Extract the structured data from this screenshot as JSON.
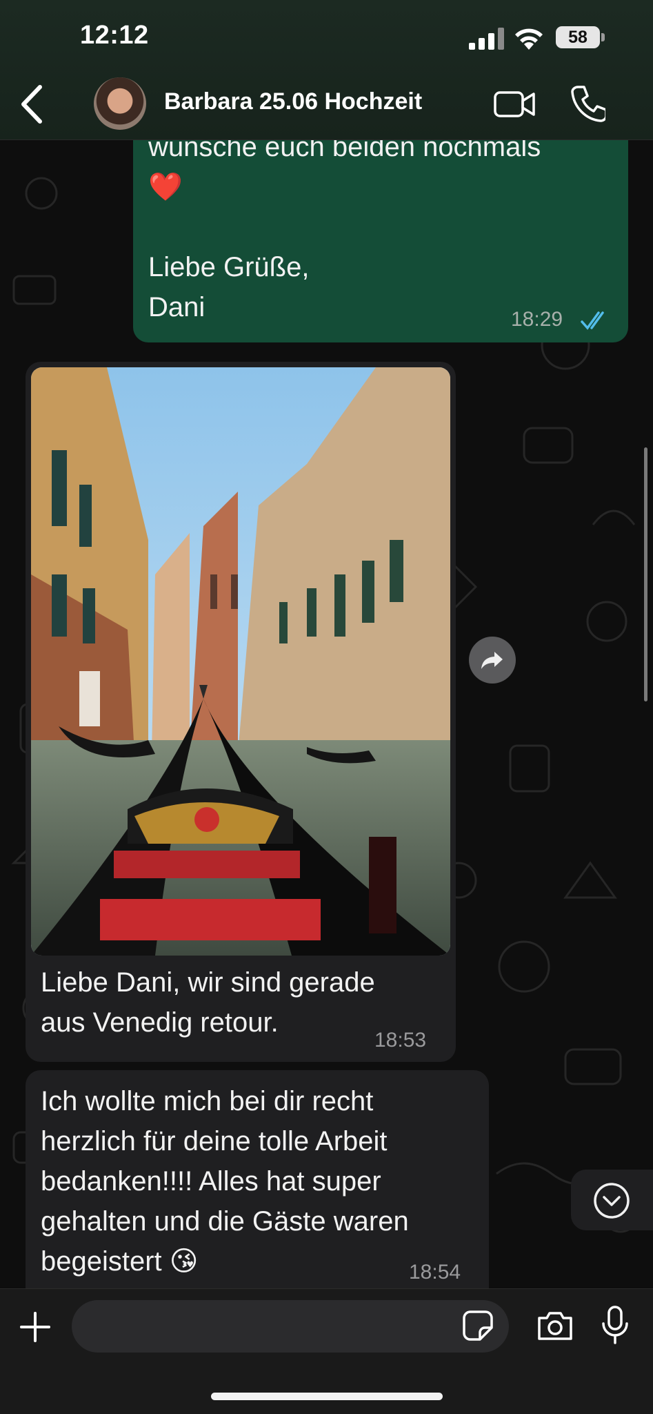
{
  "status": {
    "time": "12:12",
    "battery": "58"
  },
  "header": {
    "contact_name": "Barbara 25.06 Hochzeit"
  },
  "messages": [
    {
      "text": "wünsche euch beiden nochmals\n❤️\n\nLiebe Grüße,\nDani",
      "time": "18:29"
    },
    {
      "caption": "Liebe Dani, wir sind gerade\naus Venedig retour.",
      "time": "18:53"
    },
    {
      "text": "Ich wollte mich bei dir recht\nherzlich für deine tolle Arbeit\nbedanken!!!! Alles hat super\ngehalten und die Gäste waren\nbegeistert 😘",
      "time": "18:54"
    }
  ],
  "input": {
    "placeholder": ""
  },
  "icons": {
    "back": "chevron-left-icon",
    "video": "video-camera-icon",
    "call": "phone-icon",
    "forward": "forward-arrow-icon",
    "scroll_down": "chevron-down-circle-icon",
    "plus": "plus-icon",
    "sticker": "sticker-icon",
    "camera": "camera-icon",
    "mic": "microphone-icon",
    "read_receipt": "double-check-icon"
  },
  "colors": {
    "outgoing_bubble": "#144d37",
    "incoming_bubble": "#1f1f21",
    "read_check": "#53bdeb"
  }
}
